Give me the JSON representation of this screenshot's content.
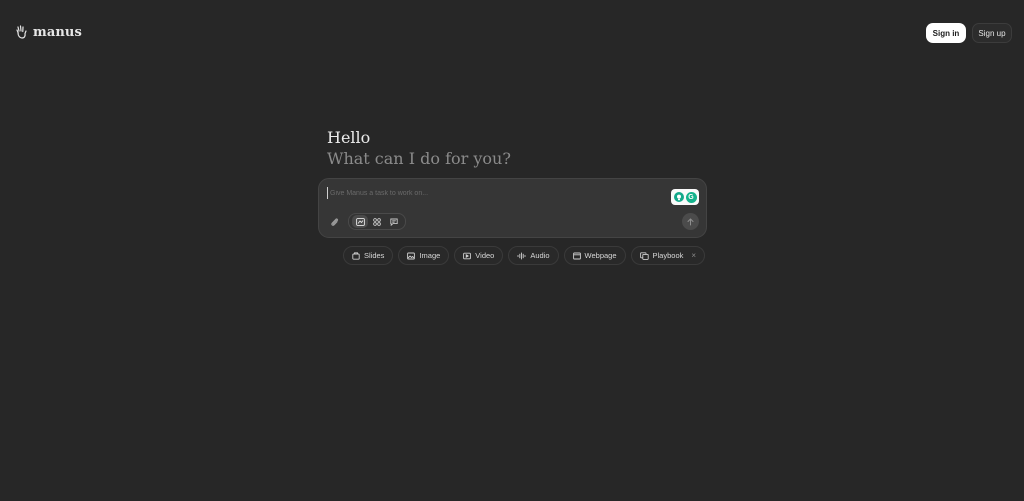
{
  "header": {
    "brand": "manus",
    "logo_icon": "manus-hand-icon",
    "sign_in_label": "Sign in",
    "sign_up_label": "Sign up"
  },
  "hero": {
    "greeting": "Hello",
    "prompt": "What can I do for you?"
  },
  "composer": {
    "placeholder": "Give Manus a task to work on...",
    "value": "",
    "modes": [
      {
        "icon": "agent-mode-icon",
        "active": true
      },
      {
        "icon": "grid-mode-icon",
        "active": false
      },
      {
        "icon": "chat-mode-icon",
        "active": false
      }
    ],
    "extension_badge_text": "G"
  },
  "chips": [
    {
      "label": "Slides",
      "icon": "slides-icon"
    },
    {
      "label": "Image",
      "icon": "image-icon"
    },
    {
      "label": "Video",
      "icon": "video-icon"
    },
    {
      "label": "Audio",
      "icon": "audio-icon"
    },
    {
      "label": "Webpage",
      "icon": "webpage-icon"
    },
    {
      "label": "Playbook",
      "icon": "playbook-icon",
      "dismissible": true,
      "dismiss_symbol": "×"
    }
  ],
  "colors": {
    "background": "#272727",
    "composer_bg": "#363636",
    "sign_in_bg": "#ffffff",
    "extension_green": "#14b38c"
  }
}
